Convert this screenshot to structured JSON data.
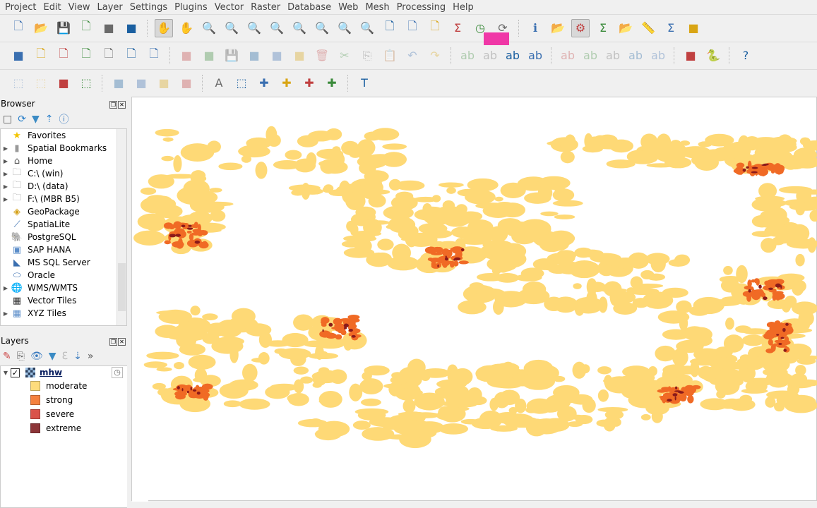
{
  "menu": [
    "Project",
    "Edit",
    "View",
    "Layer",
    "Settings",
    "Plugins",
    "Vector",
    "Raster",
    "Database",
    "Web",
    "Mesh",
    "Processing",
    "Help"
  ],
  "toolbars": [
    [
      "new-project",
      "open-project",
      "save-project",
      "new-print-layout",
      "layout-manager",
      "style-manager",
      "|",
      "pan-map*",
      "pan-to-selection",
      "zoom-in",
      "zoom-out",
      "zoom-full",
      "zoom-to-selection",
      "zoom-to-layer",
      "zoom-native",
      "zoom-last",
      "zoom-next",
      "new-map-view",
      "new-3d-map-view",
      "new-spatial-bookmark",
      "show-spatial-bookmarks",
      "temporal-controller",
      "refresh",
      "|",
      "identify-features",
      "open-attribute-table",
      "processing-toolbox*",
      "show-statistical-summary",
      "open-table-dropdown",
      "measure-line",
      "show-map-tips",
      "locator"
    ],
    [
      "data-source-manager",
      "new-geopackage-layer",
      "new-shapefile-layer",
      "new-spatialite-layer",
      "new-virtual-layer",
      "new-temporary-layer",
      "new-mesh-layer",
      "|",
      "current-edits~",
      "toggle-editing~",
      "save-layer-edits~",
      "add-feature~",
      "vertex-tool~",
      "modify-attributes~",
      "delete-selected~",
      "cut-features~",
      "copy-features~",
      "paste-features~",
      "undo~",
      "redo~",
      "|",
      "label-pin~",
      "label-show~",
      "label-layer",
      "label-toolbar",
      "|",
      "label-move~",
      "label-rotate~",
      "label-change~",
      "label-pin2~",
      "label-show2~",
      "|",
      "add-plugin-layer",
      "python-console",
      "|",
      "help"
    ],
    [
      "select-features~",
      "select-by-value~",
      "deselect-all",
      "select-by-location",
      "|",
      "digitize-ring~",
      "reshape~",
      "offset~",
      "split~",
      "|",
      "annotation-label",
      "select-annotation",
      "create-polygon-annotation",
      "create-line-annotation",
      "create-marker-annotation",
      "create-text-annotation",
      "|",
      "text-annotation"
    ]
  ],
  "browser": {
    "title": "Browser",
    "items": [
      {
        "label": "Favorites",
        "icon": "star-icon",
        "expand": false
      },
      {
        "label": "Spatial Bookmarks",
        "icon": "bookmark-icon",
        "expand": true
      },
      {
        "label": "Home",
        "icon": "home-folder-icon",
        "expand": true
      },
      {
        "label": "C:\\ (win)",
        "icon": "folder-icon",
        "expand": true
      },
      {
        "label": "D:\\ (data)",
        "icon": "folder-icon",
        "expand": true
      },
      {
        "label": "F:\\ (MBR B5)",
        "icon": "folder-icon",
        "expand": true
      },
      {
        "label": "GeoPackage",
        "icon": "geopackage-icon",
        "expand": false
      },
      {
        "label": "SpatiaLite",
        "icon": "feather-icon",
        "expand": false
      },
      {
        "label": "PostgreSQL",
        "icon": "elephant-icon",
        "expand": false
      },
      {
        "label": "SAP HANA",
        "icon": "hana-icon",
        "expand": false
      },
      {
        "label": "MS SQL Server",
        "icon": "mssql-icon",
        "expand": false
      },
      {
        "label": "Oracle",
        "icon": "oracle-icon",
        "expand": false
      },
      {
        "label": "WMS/WMTS",
        "icon": "globe-icon",
        "expand": true
      },
      {
        "label": "Vector Tiles",
        "icon": "grid-icon",
        "expand": false
      },
      {
        "label": "XYZ Tiles",
        "icon": "tiles-icon",
        "expand": true
      }
    ]
  },
  "layers": {
    "title": "Layers",
    "layer": {
      "name": "mhw",
      "checked": true
    },
    "legend": [
      {
        "label": "moderate",
        "color": "#fedc7c"
      },
      {
        "label": "strong",
        "color": "#f4813f"
      },
      {
        "label": "severe",
        "color": "#d9534a"
      },
      {
        "label": "extreme",
        "color": "#8c3538"
      }
    ]
  },
  "map_colors": {
    "moderate": "#fed976",
    "strong": "#f06a25",
    "extreme": "#8b1a1a"
  }
}
